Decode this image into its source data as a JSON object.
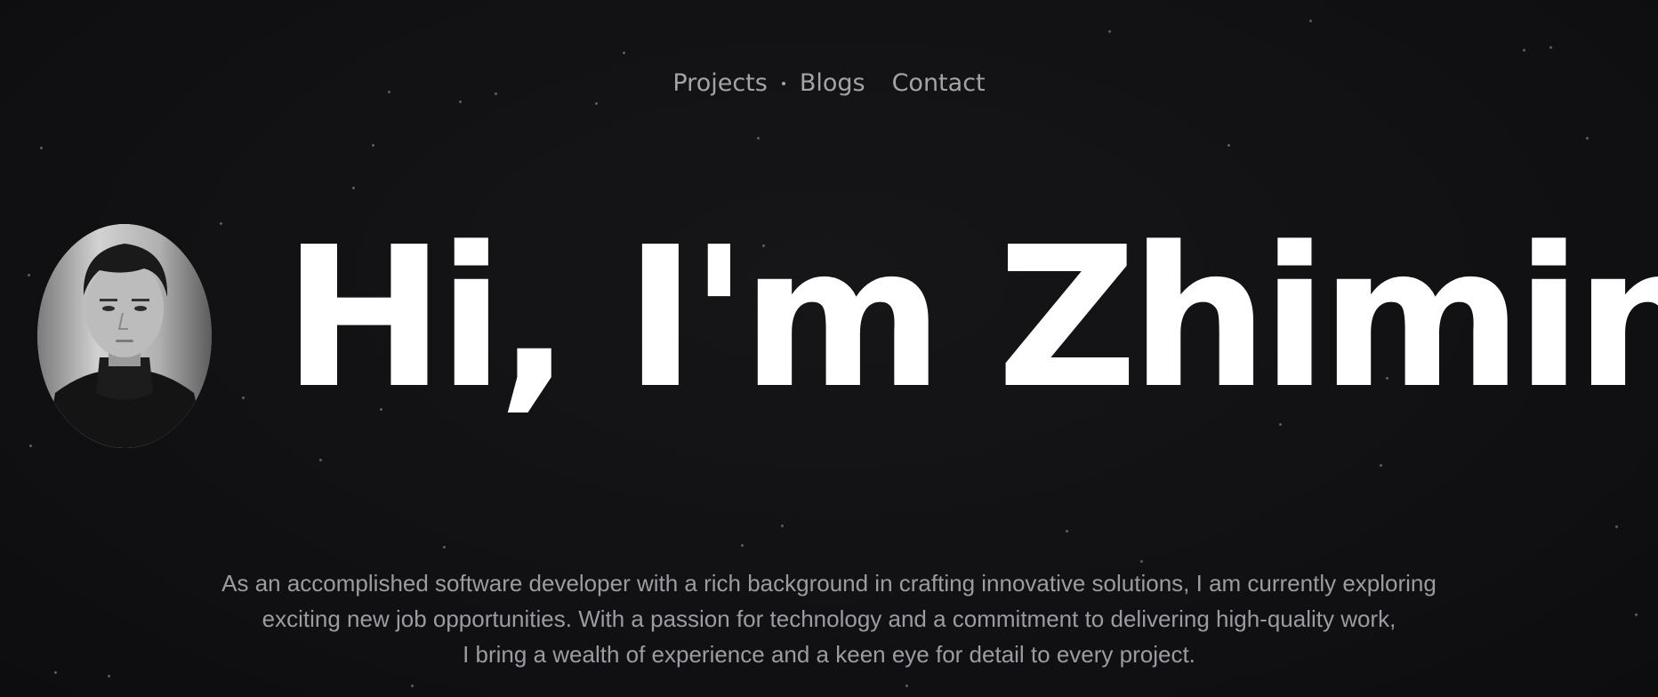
{
  "nav": {
    "items": [
      {
        "label": "Projects"
      },
      {
        "label": "Blogs"
      },
      {
        "label": "Contact"
      }
    ]
  },
  "hero": {
    "heading": "Hi, I'm Zhimin",
    "avatar_icon": "portrait-photo"
  },
  "bio": {
    "lines": [
      "As an accomplished software developer with a rich background in crafting innovative solutions, I am currently exploring",
      "exciting new job opportunities. With a passion for technology and a commitment to delivering high-quality work,",
      "I bring a wealth of experience and a keen eye for detail to every project."
    ]
  },
  "colors": {
    "background": "#111113",
    "heading": "#ffffff",
    "muted_text": "#9b9ba2"
  }
}
